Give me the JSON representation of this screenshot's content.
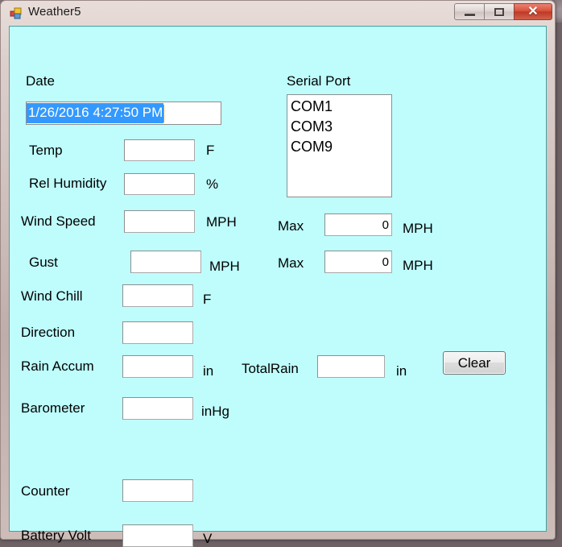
{
  "background_window": {
    "present": true,
    "legible": false
  },
  "window": {
    "title": "Weather5",
    "icon": "visual-studio-project-icon",
    "caption_buttons": {
      "minimize": "—",
      "maximize": "▭",
      "close": "✕"
    },
    "colors": {
      "client_background": "#bffdfd",
      "selection_highlight": "#3399ff",
      "frame": "#cdbdb9",
      "close_button": "#d8523c"
    }
  },
  "form": {
    "date_section": {
      "label": "Date",
      "value": "1/26/2016 4:27:50 PM",
      "selected": true
    },
    "serial_port_section": {
      "label": "Serial Port",
      "options": [
        "COM1",
        "COM3",
        "COM9"
      ],
      "selected": ""
    },
    "fields": [
      {
        "label": "Temp",
        "value": "",
        "unit": "F"
      },
      {
        "label": "Rel Humidity",
        "value": "",
        "unit": "%"
      },
      {
        "label": "Wind Speed",
        "value": "",
        "unit": "MPH"
      },
      {
        "label": "Gust",
        "value": "",
        "unit": "MPH"
      },
      {
        "label": "Wind Chill",
        "value": "",
        "unit": "F"
      },
      {
        "label": "Direction",
        "value": "",
        "unit": ""
      },
      {
        "label": "Rain Accum",
        "value": "",
        "unit": "in"
      },
      {
        "label": "Barometer",
        "value": "",
        "unit": "inHg"
      },
      {
        "label": "Counter",
        "value": "",
        "unit": ""
      },
      {
        "label": "Battery Volt",
        "value": "",
        "unit": "V"
      }
    ],
    "max_fields": [
      {
        "label": "Max",
        "value": "0",
        "unit": "MPH"
      },
      {
        "label": "Max",
        "value": "0",
        "unit": "MPH"
      }
    ],
    "total_rain": {
      "label": "TotalRain",
      "value": "",
      "unit": "in"
    },
    "clear_button": {
      "label": "Clear"
    }
  }
}
